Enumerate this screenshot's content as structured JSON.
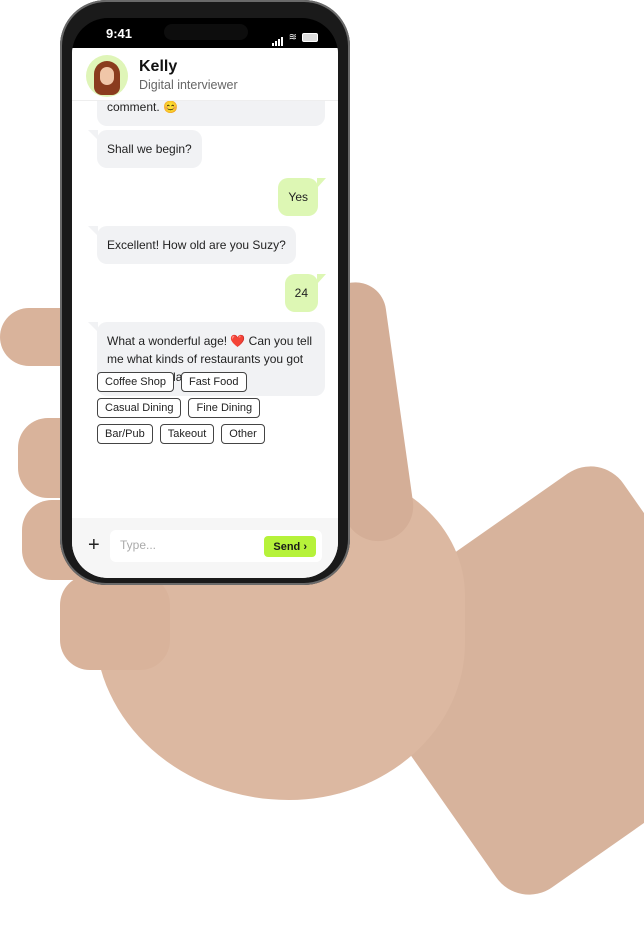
{
  "status_bar": {
    "time": "9:41"
  },
  "header": {
    "name": "Kelly",
    "role": "Digital interviewer"
  },
  "messages": [
    {
      "from": "bot",
      "text": "comment. 😊"
    },
    {
      "from": "bot",
      "text": "Shall we begin?"
    },
    {
      "from": "user",
      "text": "Yes"
    },
    {
      "from": "bot",
      "text": "Excellent! How old are you Suzy?"
    },
    {
      "from": "user",
      "text": "24"
    },
    {
      "from": "bot",
      "text": "What a wonderful age! ❤️ Can you tell me what kinds of restaurants you got to eat in the last month?"
    }
  ],
  "quick_replies": [
    "Coffee Shop",
    "Fast Food",
    "Casual Dining",
    "Fine Dining",
    "Bar/Pub",
    "Takeout",
    "Other"
  ],
  "composer": {
    "placeholder": "Type...",
    "value": "",
    "send_label": "Send ›",
    "add_icon": "+"
  },
  "colors": {
    "accent": "#b6f23a",
    "user_bubble": "#ddf7b4",
    "bot_bubble": "#f1f2f4"
  }
}
